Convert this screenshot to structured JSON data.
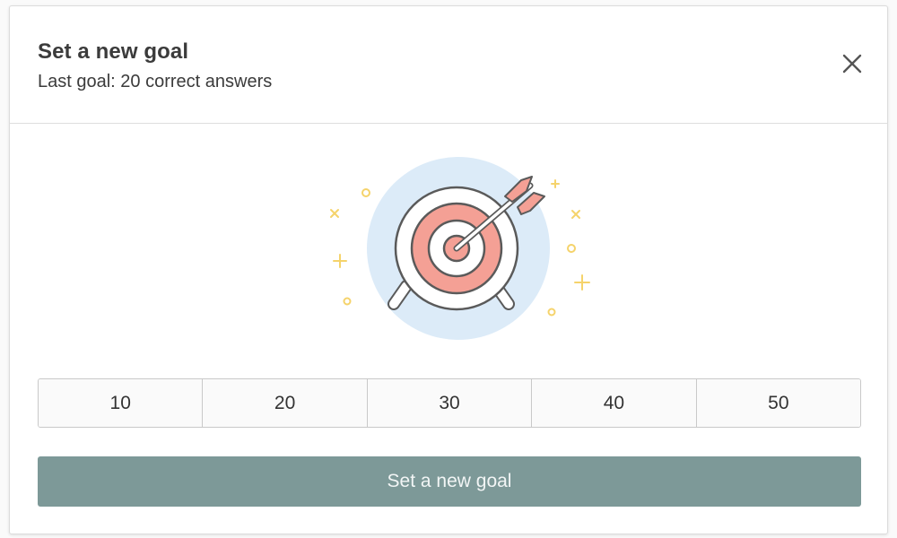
{
  "modal": {
    "title": "Set a new goal",
    "subtitle": "Last goal: 20 correct answers",
    "close_icon": "close-icon"
  },
  "illustration": {
    "icon": "target-with-arrow-icon",
    "colors": {
      "halo": "#dcebf8",
      "ring_red": "#f4a095",
      "ring_white": "#ffffff",
      "outline": "#5a5a5a",
      "sparkle": "#f5d36b"
    }
  },
  "goal_options": [
    "10",
    "20",
    "30",
    "40",
    "50"
  ],
  "submit_label": "Set a new goal",
  "colors": {
    "submit_bg": "#7d9998",
    "title_text": "#3b3b3b"
  }
}
